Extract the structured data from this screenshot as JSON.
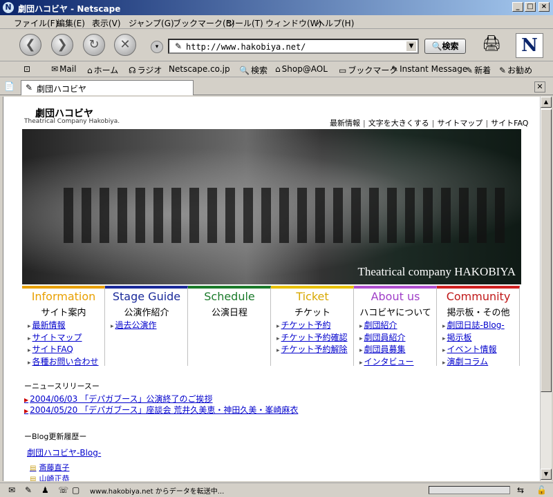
{
  "window": {
    "title": "劇団ハコビヤ - Netscape",
    "logo_letter": "N"
  },
  "menu": [
    "ファイル(F)",
    "編集(E)",
    "表示(V)",
    "ジャンプ(G)",
    "ブックマーク(B)",
    "ツール(T)",
    "ウィンドウ(W)",
    "ヘルプ(H)"
  ],
  "navbar": {
    "url": "http://www.hakobiya.net/",
    "search_label": "検索",
    "netscape_letter": "N"
  },
  "personal": [
    "Mail",
    "ホーム",
    "ラジオ",
    "Netscape.co.jp",
    "検索",
    "Shop@AOL",
    "ブックマーク",
    "Instant Message",
    "新着",
    "お勧め"
  ],
  "tab": {
    "title": "劇団ハコビヤ"
  },
  "page": {
    "logo_ja": "劇団ハコビヤ",
    "logo_en": "Theatrical Company Hakobiya.",
    "top_links": [
      "最新情報",
      "文字を大きくする",
      "サイトマップ",
      "サイトFAQ"
    ],
    "hero_caption": "Theatrical company HAKOBIYA",
    "categories": [
      {
        "en": "Information",
        "ja": "サイト案内",
        "color": "#e8a000",
        "en_color": "#e8a000",
        "links": [
          "最新情報",
          "サイトマップ",
          "サイトFAQ",
          "各種お問い合わせ"
        ]
      },
      {
        "en": "Stage Guide",
        "ja": "公演作紹介",
        "color": "#1a2a9a",
        "en_color": "#1a2a9a",
        "links": [
          "過去公演作"
        ]
      },
      {
        "en": "Schedule",
        "ja": "公演日程",
        "color": "#1a7a2a",
        "en_color": "#1a7a2a",
        "links": []
      },
      {
        "en": "Ticket",
        "ja": "チケット",
        "color": "#e8c000",
        "en_color": "#d8a800",
        "links": [
          "チケット予約",
          "チケット予約確認",
          "チケット予約解除"
        ]
      },
      {
        "en": "About us",
        "ja": "ハコビヤについて",
        "color": "#b050d0",
        "en_color": "#a040c8",
        "links": [
          "劇団紹介",
          "劇団員紹介",
          "劇団員募集",
          "インタビュー"
        ]
      },
      {
        "en": "Community",
        "ja": "掲示板・その他",
        "color": "#d02020",
        "en_color": "#c01818",
        "links": [
          "劇団日誌-Blog-",
          "掲示板",
          "イベント情報",
          "演劇コラム"
        ]
      }
    ],
    "news_header": "ーニュースリリースー",
    "news": [
      "2004/06/03 「デパガブース」公演終了のご挨拶",
      "2004/05/20 「デパガブース」座談会 荒井久美恵・神田久美・峯崎麻衣"
    ],
    "blog_header": "ーBlog更新履歴ー",
    "blog_link": "劇団ハコビヤ-Blog-",
    "blog_members": [
      "斎藤直子",
      "山崎正恭"
    ]
  },
  "status": {
    "text": "www.hakobiya.net からデータを転送中...",
    "progress": 0
  }
}
